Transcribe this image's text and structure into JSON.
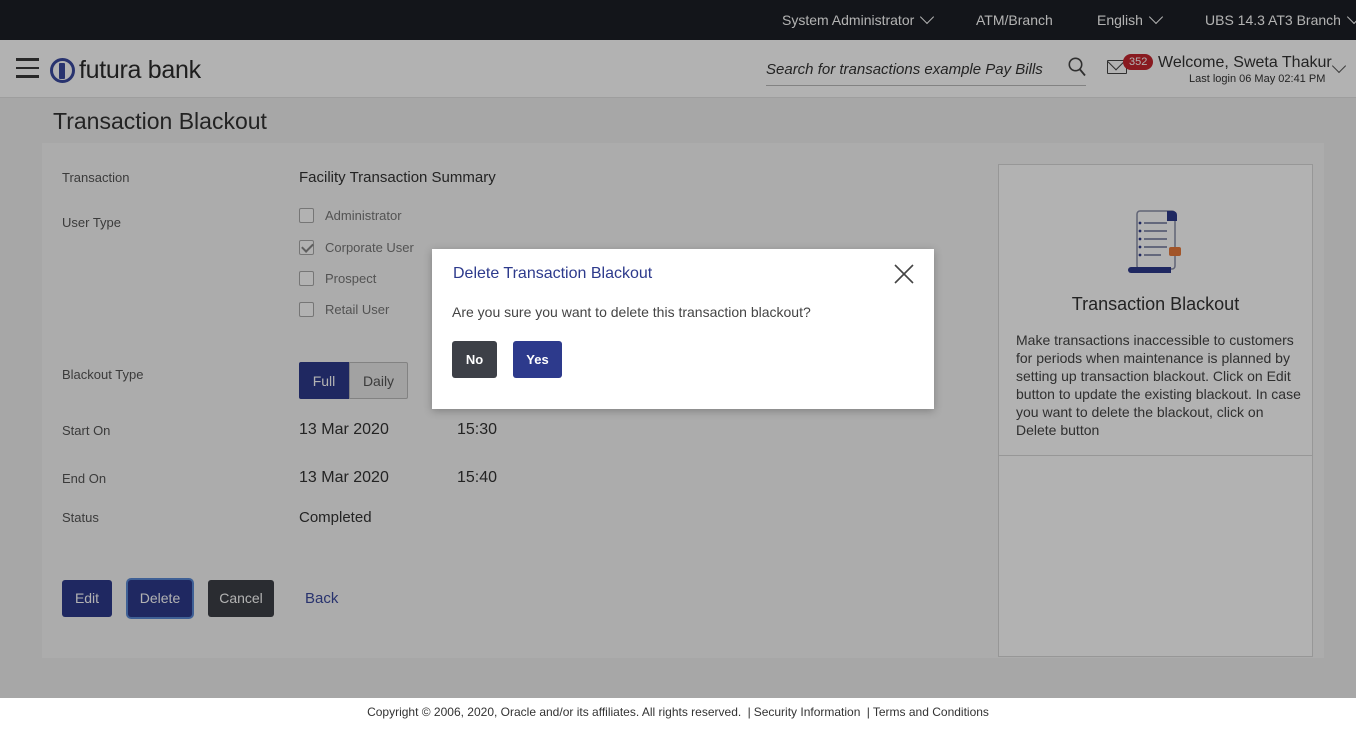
{
  "topbar": {
    "role": "System Administrator",
    "atm_branch": "ATM/Branch",
    "language": "English",
    "branch": "UBS 14.3 AT3 Branch"
  },
  "header": {
    "brand": "futura bank",
    "search_placeholder": "Search for transactions example Pay Bills",
    "notification_count": "352",
    "welcome": "Welcome, Sweta Thakur",
    "last_login": "Last login 06 May 02:41 PM"
  },
  "page": {
    "title": "Transaction Blackout"
  },
  "form": {
    "transaction_label": "Transaction",
    "transaction_value": "Facility Transaction Summary",
    "user_type_label": "User Type",
    "user_types": [
      {
        "label": "Administrator",
        "checked": false
      },
      {
        "label": "Corporate User",
        "checked": true
      },
      {
        "label": "Prospect",
        "checked": false
      },
      {
        "label": "Retail User",
        "checked": false
      }
    ],
    "blackout_type_label": "Blackout Type",
    "blackout_type_options": [
      "Full",
      "Daily"
    ],
    "blackout_type_selected": "Full",
    "start_on_label": "Start On",
    "start_date": "13 Mar 2020",
    "start_time": "15:30",
    "end_on_label": "End On",
    "end_date": "13 Mar 2020",
    "end_time": "15:40",
    "status_label": "Status",
    "status_value": "Completed"
  },
  "actions": {
    "edit": "Edit",
    "delete": "Delete",
    "cancel": "Cancel",
    "back": "Back"
  },
  "help": {
    "title": "Transaction Blackout",
    "text": "Make transactions inaccessible to customers for periods when maintenance is planned by setting up transaction blackout. Click on Edit button to update the existing blackout. In case you want to delete the blackout, click on Delete button"
  },
  "modal": {
    "title": "Delete Transaction Blackout",
    "message": "Are you sure you want to delete this transaction blackout?",
    "no": "No",
    "yes": "Yes"
  },
  "footer": {
    "copyright": "Copyright © 2006, 2020, Oracle and/or its affiliates. All rights reserved.",
    "sep": "|",
    "security": "Security Information",
    "terms": "Terms and Conditions"
  },
  "colors": {
    "primary": "#2d3a8c",
    "topbar": "#1c1f26",
    "badge": "#c4262e",
    "dark_button": "#3d4047"
  }
}
